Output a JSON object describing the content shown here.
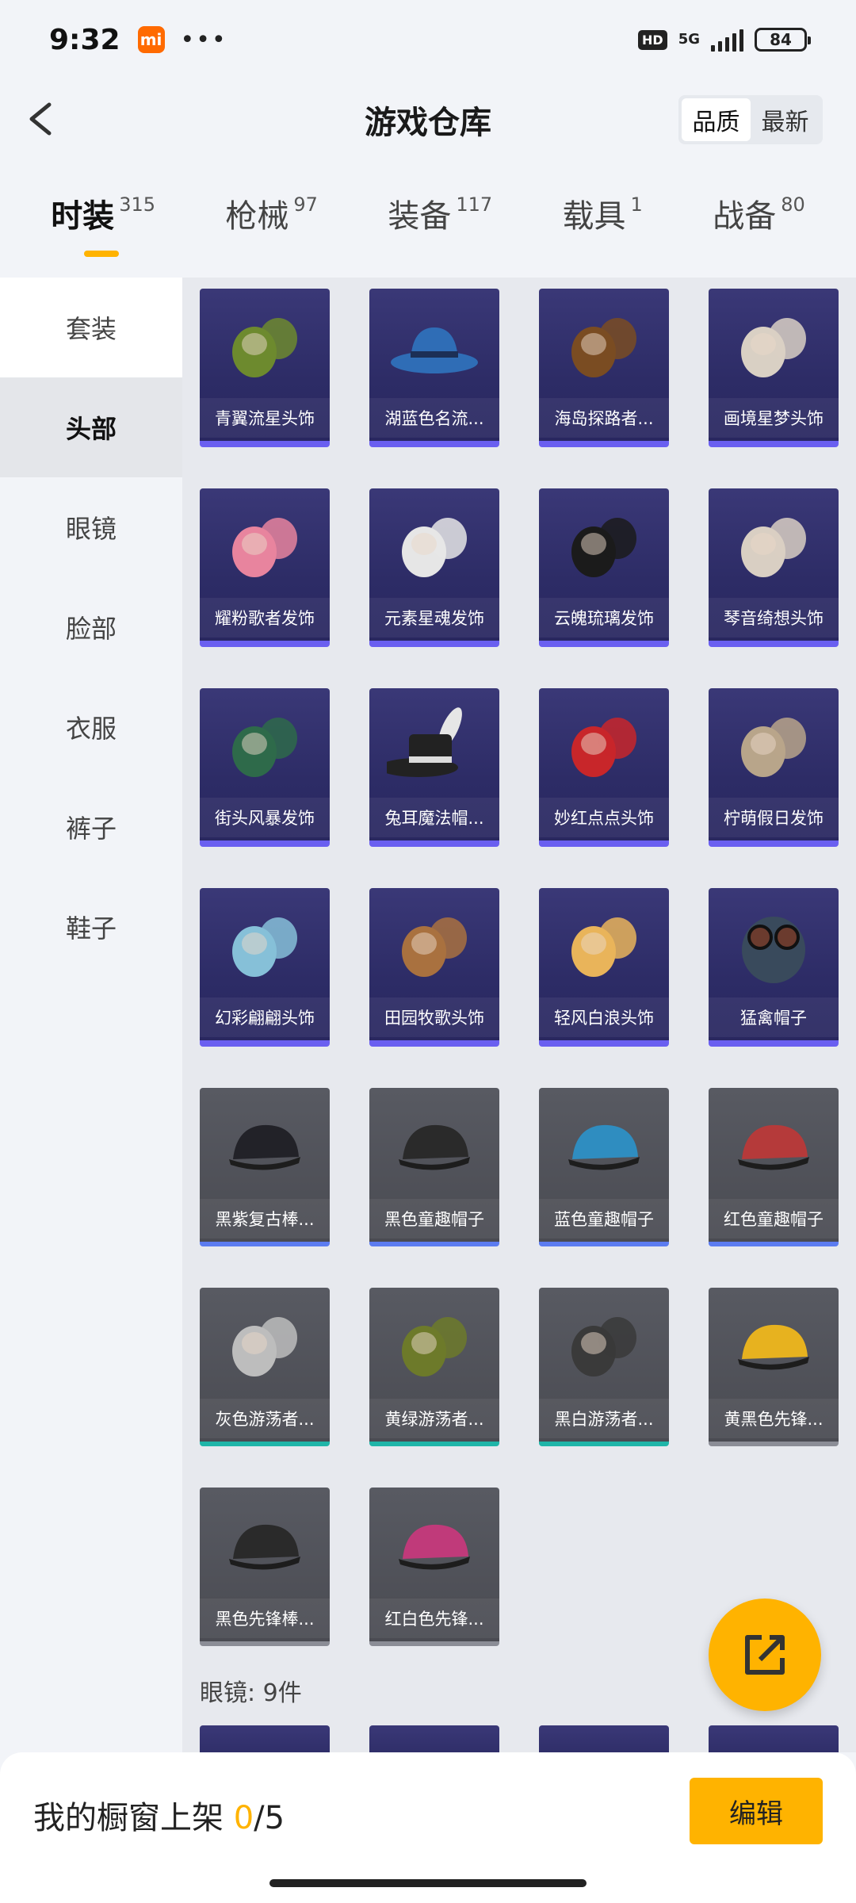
{
  "status": {
    "time": "9:32",
    "hd": "HD",
    "net": "5G",
    "battery": "84"
  },
  "header": {
    "title": "游戏仓库",
    "sort": [
      "品质",
      "最新"
    ],
    "sort_active": 0
  },
  "categories": [
    {
      "name": "时装",
      "count": "315"
    },
    {
      "name": "枪械",
      "count": "97"
    },
    {
      "name": "装备",
      "count": "117"
    },
    {
      "name": "载具",
      "count": "1"
    },
    {
      "name": "战备",
      "count": "80"
    }
  ],
  "sidebar": [
    "套装",
    "头部",
    "眼镜",
    "脸部",
    "衣服",
    "裤子",
    "鞋子"
  ],
  "items": [
    {
      "name": "青翼流星头饰",
      "style": "purple",
      "icon": "green-hair-icon",
      "color": "#6d8a2e"
    },
    {
      "name": "湖蓝色名流...",
      "style": "purple",
      "icon": "blue-hat-icon",
      "color": "#2f6db6"
    },
    {
      "name": "海岛探路者...",
      "style": "purple",
      "icon": "brown-hair-icon",
      "color": "#7a4c22"
    },
    {
      "name": "画境星梦头饰",
      "style": "purple",
      "icon": "white-hair-icon",
      "color": "#d9d0c4"
    },
    {
      "name": "耀粉歌者发饰",
      "style": "purple",
      "icon": "pink-hair-icon",
      "color": "#e8849e"
    },
    {
      "name": "元素星魂发饰",
      "style": "purple",
      "icon": "silver-hair-icon",
      "color": "#e6e6e6"
    },
    {
      "name": "云魄琉璃发饰",
      "style": "purple",
      "icon": "black-hair-icon",
      "color": "#1b1b1b"
    },
    {
      "name": "琴音绮想头饰",
      "style": "purple",
      "icon": "cream-hair-icon",
      "color": "#d9cfc3"
    },
    {
      "name": "街头风暴发饰",
      "style": "purple",
      "icon": "street-hair-icon",
      "color": "#2e6a4a"
    },
    {
      "name": "兔耳魔法帽...",
      "style": "purple",
      "icon": "bunny-hat-icon",
      "color": "#222222"
    },
    {
      "name": "妙红点点头饰",
      "style": "purple",
      "icon": "red-cap-icon",
      "color": "#c8262a"
    },
    {
      "name": "柠萌假日发饰",
      "style": "purple",
      "icon": "braid-hair-icon",
      "color": "#b8a58a"
    },
    {
      "name": "幻彩翩翩头饰",
      "style": "purple",
      "icon": "sun-hat-icon",
      "color": "#86c0d8"
    },
    {
      "name": "田园牧歌头饰",
      "style": "purple",
      "icon": "straw-hat-icon",
      "color": "#a9713f"
    },
    {
      "name": "轻风白浪头饰",
      "style": "purple",
      "icon": "light-hair-icon",
      "color": "#e9b45a"
    },
    {
      "name": "猛禽帽子",
      "style": "purple",
      "icon": "aviator-helmet-icon",
      "color": "#394a5c"
    },
    {
      "name": "黑紫复古棒...",
      "style": "grey",
      "line": "blueline",
      "icon": "black-cap-icon",
      "color": "#222228"
    },
    {
      "name": "黑色童趣帽子",
      "style": "grey",
      "line": "blueline",
      "icon": "black-cap-icon",
      "color": "#2a2a2a"
    },
    {
      "name": "蓝色童趣帽子",
      "style": "grey",
      "line": "blueline",
      "icon": "blue-cap-icon",
      "color": "#2f8dc0"
    },
    {
      "name": "红色童趣帽子",
      "style": "grey",
      "line": "blueline",
      "icon": "red-cap-icon",
      "color": "#b53a3a"
    },
    {
      "name": "灰色游荡者...",
      "style": "grey",
      "line": "tealline",
      "icon": "beanie-icon",
      "color": "#bdbdbd"
    },
    {
      "name": "黄绿游荡者...",
      "style": "grey",
      "line": "tealline",
      "icon": "beanie-icon",
      "color": "#6d7a2a"
    },
    {
      "name": "黑白游荡者...",
      "style": "grey",
      "line": "tealline",
      "icon": "beanie-icon",
      "color": "#3a3a3a"
    },
    {
      "name": "黄黑色先锋...",
      "style": "grey",
      "line": "greyline",
      "icon": "baseball-cap-icon",
      "color": "#e7b21f"
    },
    {
      "name": "黑色先锋棒...",
      "style": "grey",
      "line": "greyline",
      "icon": "baseball-cap-icon",
      "color": "#2a2a2a"
    },
    {
      "name": "红白色先锋...",
      "style": "grey",
      "line": "greyline",
      "icon": "baseball-cap-icon",
      "color": "#c03a7a"
    }
  ],
  "next_section": {
    "label": "眼镜: 9件"
  },
  "bottom": {
    "text_prefix": "我的橱窗上架 ",
    "count": "0",
    "total": "/5",
    "edit": "编辑"
  }
}
